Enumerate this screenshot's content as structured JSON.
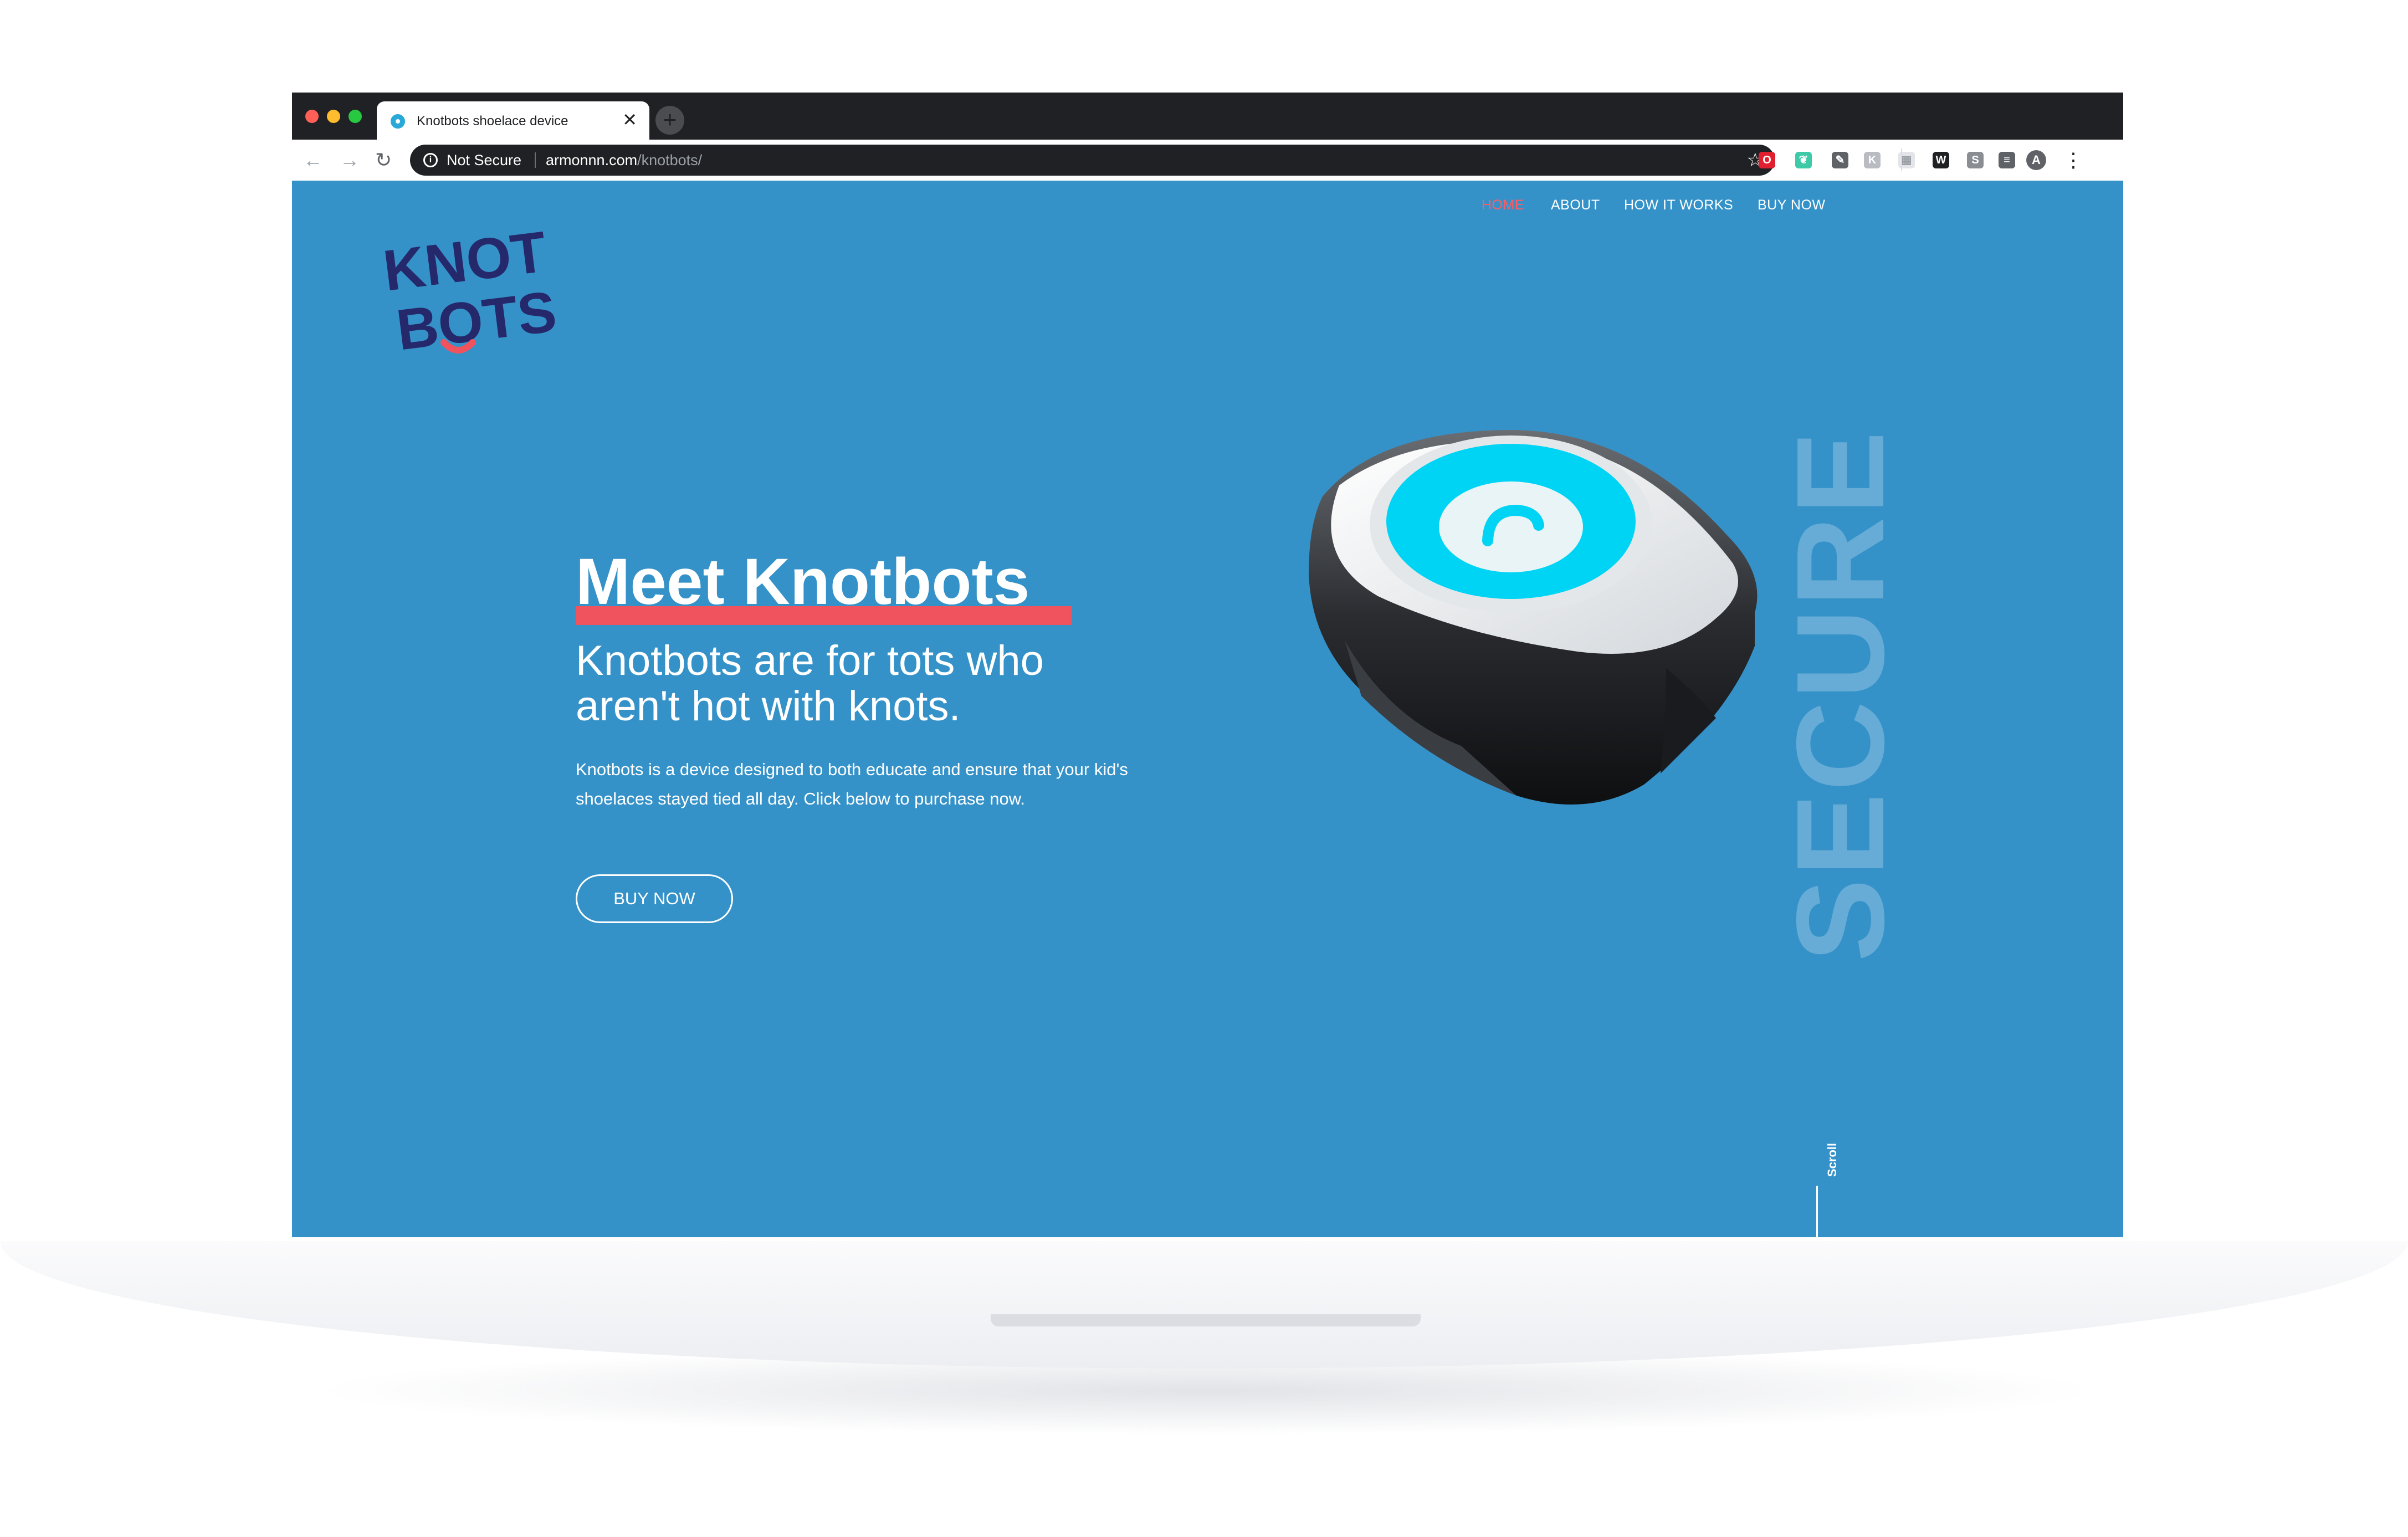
{
  "browser": {
    "tab": {
      "title": "Knotbots shoelace device",
      "close_glyph": "✕",
      "favicon": "knotbots-favicon"
    },
    "new_tab_glyph": "+",
    "toolbar": {
      "back_glyph": "←",
      "forward_glyph": "→",
      "reload_glyph": "↻",
      "security_label": "Not Secure",
      "info_glyph": "i",
      "url_domain": "armonnn.com",
      "url_path": "/knotbots/",
      "bookmark_glyph": "☆",
      "profile_letter": "A",
      "menu_glyph": "⋮",
      "extensions": [
        {
          "name": "opera-ext-icon",
          "glyph": "O",
          "color": "#e0202e"
        },
        {
          "name": "mint-ext-icon",
          "glyph": "❦",
          "color": "#3ec9a7"
        },
        {
          "name": "eyedropper-ext-icon",
          "glyph": "✎",
          "color": "#5f6368"
        },
        {
          "name": "k-ext-icon",
          "glyph": "K",
          "color": "#b9bcc2"
        },
        {
          "name": "grid-ext-icon",
          "glyph": "▦",
          "color": "#e3e5e8"
        },
        {
          "name": "w-ext-icon",
          "glyph": "W",
          "color": "#202124"
        },
        {
          "name": "s-ext-icon",
          "glyph": "S",
          "color": "#8a8d91"
        },
        {
          "name": "playlist-ext-icon",
          "glyph": "≡",
          "color": "#5f6368"
        }
      ]
    },
    "colors": {
      "close": "#ff5f57",
      "minimize": "#febc2e",
      "maximize": "#28c840"
    }
  },
  "site": {
    "logo": {
      "line1": "KNOT",
      "line2": "BOTS"
    },
    "nav": [
      "HOME",
      "ABOUT",
      "HOW IT WORKS",
      "BUY NOW"
    ],
    "hero": {
      "title": "Meet Knotbots",
      "subtitle": "Knotbots are for tots who aren't hot with knots.",
      "body": "Knotbots is a device designed to both educate and ensure that your kid's shoelaces stayed tied all day. Click below to purchase now.",
      "cta": "BUY NOW"
    },
    "vertical_word": "SECURE",
    "scroll_label": "Scroll",
    "colors": {
      "background": "#3592c8",
      "accent": "#f0535d",
      "logo": "#25286a",
      "device_ring": "#00d4f5"
    }
  }
}
